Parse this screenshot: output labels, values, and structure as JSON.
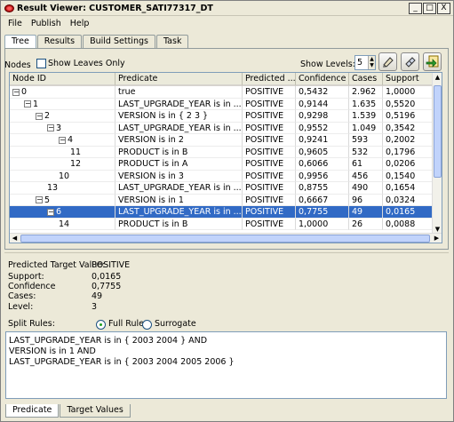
{
  "window": {
    "title": "Result Viewer: CUSTOMER_SATI77317_DT",
    "controls": [
      "_",
      "□",
      "X"
    ]
  },
  "menu": [
    "File",
    "Publish",
    "Help"
  ],
  "tabs": [
    "Tree",
    "Results",
    "Build Settings",
    "Task"
  ],
  "toolbar": {
    "nodes_label": "Nodes",
    "show_leaves_label": "Show Leaves Only",
    "show_levels_label": "Show Levels:",
    "levels_value": "5"
  },
  "table": {
    "columns": [
      "Node ID",
      "Predicate",
      "Predicted ...",
      "Confidence",
      "Cases",
      "Support"
    ],
    "rows": [
      {
        "id": "0",
        "level": 0,
        "toggle": "−",
        "predicate": "true",
        "predicted": "POSITIVE",
        "confidence": "0,5432",
        "cases": "2.962",
        "support": "1,0000"
      },
      {
        "id": "1",
        "level": 1,
        "toggle": "−",
        "predicate": "LAST_UPGRADE_YEAR is in ...",
        "predicted": "POSITIVE",
        "confidence": "0,9144",
        "cases": "1.635",
        "support": "0,5520"
      },
      {
        "id": "2",
        "level": 2,
        "toggle": "−",
        "predicate": "VERSION is in { 2 3 }",
        "predicted": "POSITIVE",
        "confidence": "0,9298",
        "cases": "1.539",
        "support": "0,5196"
      },
      {
        "id": "3",
        "level": 3,
        "toggle": "−",
        "predicate": "LAST_UPGRADE_YEAR is in ...",
        "predicted": "POSITIVE",
        "confidence": "0,9552",
        "cases": "1.049",
        "support": "0,3542"
      },
      {
        "id": "4",
        "level": 4,
        "toggle": "−",
        "predicate": "VERSION is in 2",
        "predicted": "POSITIVE",
        "confidence": "0,9241",
        "cases": "593",
        "support": "0,2002"
      },
      {
        "id": "11",
        "level": 5,
        "toggle": "",
        "predicate": "PRODUCT is in B",
        "predicted": "POSITIVE",
        "confidence": "0,9605",
        "cases": "532",
        "support": "0,1796"
      },
      {
        "id": "12",
        "level": 5,
        "toggle": "",
        "predicate": "PRODUCT is in A",
        "predicted": "POSITIVE",
        "confidence": "0,6066",
        "cases": "61",
        "support": "0,0206"
      },
      {
        "id": "10",
        "level": 4,
        "toggle": "",
        "predicate": "VERSION is in 3",
        "predicted": "POSITIVE",
        "confidence": "0,9956",
        "cases": "456",
        "support": "0,1540"
      },
      {
        "id": "13",
        "level": 3,
        "toggle": "",
        "predicate": "LAST_UPGRADE_YEAR is in ...",
        "predicted": "POSITIVE",
        "confidence": "0,8755",
        "cases": "490",
        "support": "0,1654"
      },
      {
        "id": "5",
        "level": 2,
        "toggle": "−",
        "predicate": "VERSION is in 1",
        "predicted": "POSITIVE",
        "confidence": "0,6667",
        "cases": "96",
        "support": "0,0324"
      },
      {
        "id": "6",
        "level": 3,
        "toggle": "−",
        "predicate": "LAST_UPGRADE_YEAR is in ...",
        "predicted": "POSITIVE",
        "confidence": "0,7755",
        "cases": "49",
        "support": "0,0165",
        "selected": true
      },
      {
        "id": "14",
        "level": 4,
        "toggle": "",
        "predicate": "PRODUCT is in B",
        "predicted": "POSITIVE",
        "confidence": "1,0000",
        "cases": "26",
        "support": "0,0088"
      }
    ]
  },
  "details": {
    "predicted_target_label": "Predicted Target Value:",
    "predicted_target_value": "POSITIVE",
    "support_label": "Support:",
    "support_value": "0,0165",
    "confidence_label": "Confidence",
    "confidence_value": "0,7755",
    "cases_label": "Cases:",
    "cases_value": "49",
    "level_label": "Level:",
    "level_value": "3"
  },
  "split_rules": {
    "label": "Split Rules:",
    "full_rule_label": "Full Rule",
    "surrogate_label": "Surrogate",
    "lines": [
      "LAST_UPGRADE_YEAR is in { 2003 2004 } AND",
      "VERSION is in 1 AND",
      "LAST_UPGRADE_YEAR is in { 2003 2004 2005 2006 }"
    ]
  },
  "bottom_tabs": [
    "Predicate",
    "Target Values"
  ]
}
